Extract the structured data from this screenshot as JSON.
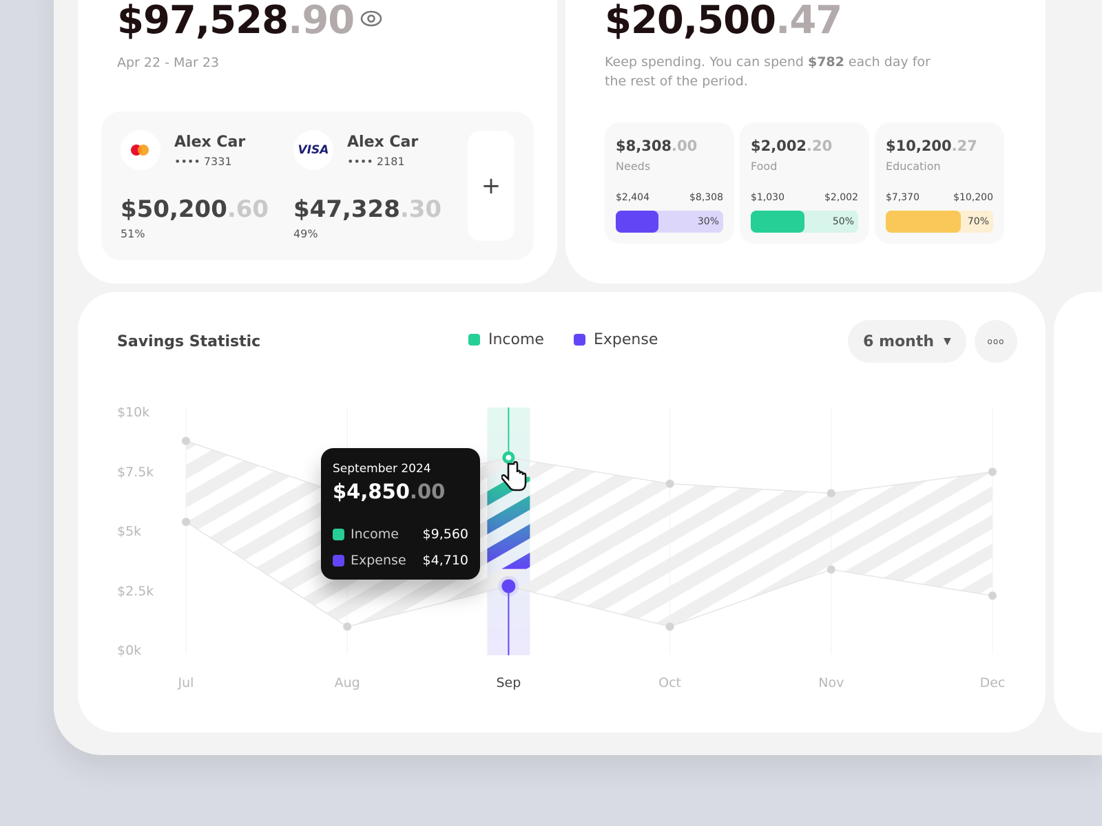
{
  "balance": {
    "whole": "$97,528",
    "dec": ".90",
    "period": "Apr 22 - Mar 23"
  },
  "cards": [
    {
      "brand": "mastercard",
      "name": "Alex Car",
      "number": "•••• 7331",
      "whole": "$50,200",
      "dec": ".60",
      "share": "51%"
    },
    {
      "brand": "VISA",
      "name": "Alex Car",
      "number": "•••• 2181",
      "whole": "$47,328",
      "dec": ".30",
      "share": "49%"
    }
  ],
  "add_card": "+",
  "spend": {
    "whole": "$20,500",
    "dec": ".47",
    "msg_a": "Keep spending. You can spend ",
    "msg_b": "$782",
    "msg_c": " each day for the rest of the period."
  },
  "budgets": [
    {
      "whole": "$8,308",
      "dec": ".00",
      "label": "Needs",
      "low": "$2,404",
      "high": "$8,308",
      "pct": "30%",
      "fill": 0.4,
      "color": "#6246f5",
      "track": "#dcd6fb"
    },
    {
      "whole": "$2,002",
      "dec": ".20",
      "label": "Food",
      "low": "$1,030",
      "high": "$2,002",
      "pct": "50%",
      "fill": 0.5,
      "color": "#26cf95",
      "track": "#d7f5ea"
    },
    {
      "whole": "$10,200",
      "dec": ".27",
      "label": "Education",
      "low": "$7,370",
      "high": "$10,200",
      "pct": "70%",
      "fill": 0.7,
      "color": "#f9c858",
      "track": "#fcefd2"
    }
  ],
  "savings": {
    "title": "Savings Statistic",
    "legend_income": "Income",
    "legend_expense": "Expense",
    "period": "6 month",
    "more": "ooo"
  },
  "tooltip": {
    "month": "September 2024",
    "whole": "$4,850",
    "dec": ".00",
    "income_label": "Income",
    "income": "$9,560",
    "expense_label": "Expense",
    "expense": "$4,710"
  },
  "chart_data": {
    "type": "line",
    "title": "Savings Statistic",
    "categories": [
      "Jul",
      "Aug",
      "Sep",
      "Oct",
      "Nov",
      "Dec"
    ],
    "yticks": [
      "$0k",
      "$2.5k",
      "$5k",
      "$7.5k",
      "$10k"
    ],
    "ylim": [
      0,
      10
    ],
    "series": [
      {
        "name": "Income",
        "color": "#26cf95",
        "values": [
          8.8,
          6.5,
          8.1,
          7.0,
          6.6,
          7.5
        ]
      },
      {
        "name": "Expense",
        "color": "#6246f5",
        "values": [
          5.4,
          1.0,
          2.7,
          1.0,
          3.4,
          2.3
        ]
      }
    ],
    "highlight": "Sep"
  }
}
